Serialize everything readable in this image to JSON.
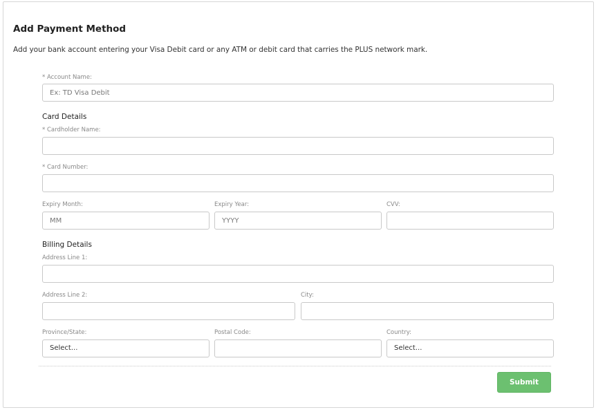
{
  "header": {
    "title": "Add Payment Method",
    "description": "Add your bank account entering your Visa Debit card or any ATM or debit card that carries the PLUS network mark."
  },
  "account": {
    "label": "* Account Name:",
    "placeholder": "Ex: TD Visa Debit",
    "value": ""
  },
  "card_details": {
    "heading": "Card Details",
    "cardholder_label": "* Cardholder Name:",
    "card_number_label": "* Card Number:",
    "expiry_month_label": "Expiry Month:",
    "expiry_month_placeholder": "MM",
    "expiry_year_label": "Expiry Year:",
    "expiry_year_placeholder": "YYYY",
    "cvv_label": "CVV:"
  },
  "billing_details": {
    "heading": "Billing Details",
    "address1_label": "Address Line 1:",
    "address2_label": "Address Line 2:",
    "city_label": "City:",
    "province_label": "Province/State:",
    "province_value": "Select...",
    "postal_label": "Postal Code:",
    "country_label": "Country:",
    "country_value": "Select..."
  },
  "actions": {
    "submit_label": "Submit"
  },
  "colors": {
    "submit_bg": "#6cc070",
    "border": "#c8c8c8",
    "label": "#888888"
  }
}
